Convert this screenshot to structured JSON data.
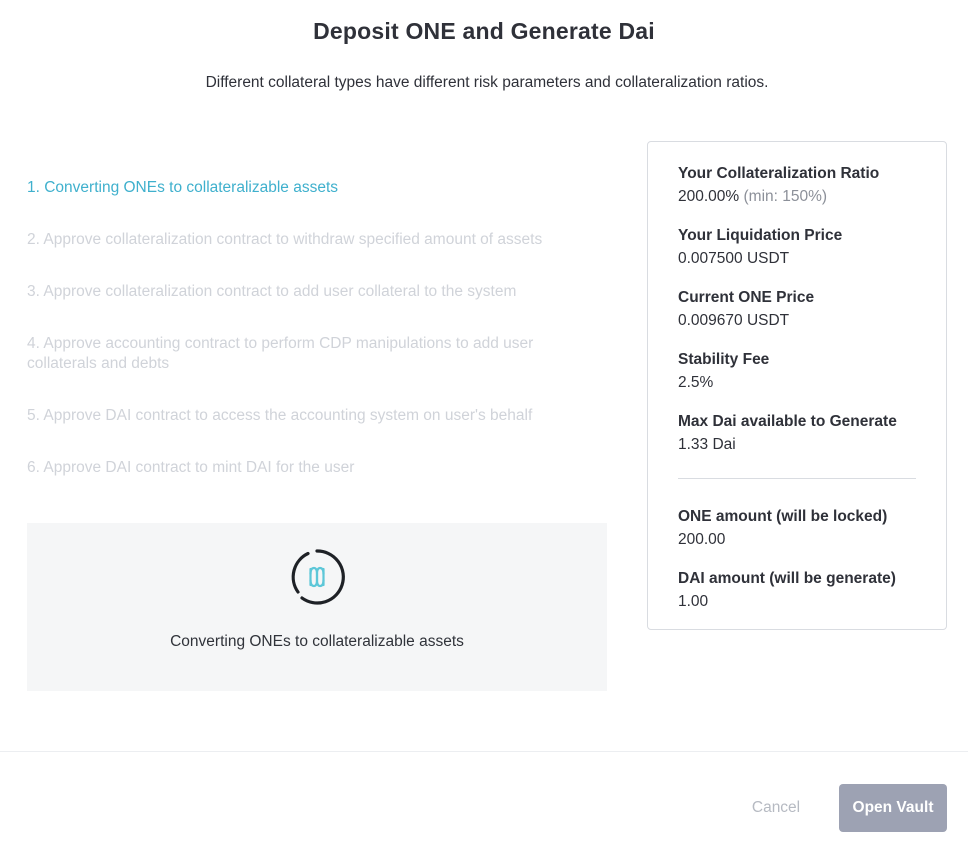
{
  "header": {
    "title": "Deposit ONE and Generate Dai",
    "subtitle": "Different collateral types have different risk parameters and collateralization ratios."
  },
  "steps": [
    {
      "label": "1. Converting ONEs to collateralizable assets",
      "state": "active"
    },
    {
      "label": "2. Approve collateralization contract to withdraw specified amount of assets",
      "state": "pending"
    },
    {
      "label": "3. Approve collateralization contract to add user collateral to the system",
      "state": "pending"
    },
    {
      "label": "4. Approve accounting contract to perform CDP manipulations to add user collaterals and debts",
      "state": "pending"
    },
    {
      "label": "5. Approve DAI contract to access the accounting system on user's behalf",
      "state": "pending"
    },
    {
      "label": "6. Approve DAI contract to mint DAI for the user",
      "state": "pending"
    }
  ],
  "progress": {
    "label": "Converting ONEs to collateralizable assets",
    "icon": "harmony-logo-spinner-icon"
  },
  "summary": {
    "collateralization_ratio": {
      "label": "Your Collateralization Ratio",
      "value": "200.00%",
      "hint": "(min: 150%)"
    },
    "liquidation_price": {
      "label": "Your Liquidation Price",
      "value": "0.007500 USDT"
    },
    "current_price": {
      "label": "Current ONE Price",
      "value": "0.009670 USDT"
    },
    "stability_fee": {
      "label": "Stability Fee",
      "value": "2.5%"
    },
    "max_dai": {
      "label": "Max Dai available to Generate",
      "value": "1.33 Dai"
    },
    "one_amount": {
      "label": "ONE amount (will be locked)",
      "value": "200.00"
    },
    "dai_amount": {
      "label": "DAI amount (will be generate)",
      "value": "1.00"
    }
  },
  "footer": {
    "cancel_label": "Cancel",
    "open_label": "Open Vault"
  },
  "colors": {
    "accent": "#3fb0cd",
    "pending_text": "#d0d3d9",
    "button_disabled": "#9da2b3"
  }
}
